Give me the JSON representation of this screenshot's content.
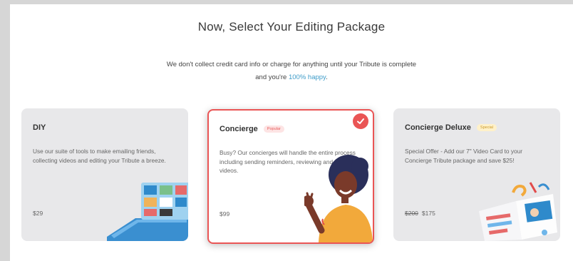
{
  "header": {
    "title": "Now, Select Your Editing Package",
    "subtitle_line1": "We don't collect credit card info or charge for anything until your Tribute is complete",
    "subtitle_line2_prefix": "and you're ",
    "subtitle_line2_accent": "100% happy",
    "subtitle_line2_suffix": "."
  },
  "packages": [
    {
      "name": "DIY",
      "badge": "",
      "description": "Use our suite of tools to make emailing friends, collecting videos and editing your Tribute a breeze.",
      "price_old": "",
      "price": "$29",
      "selected": false,
      "illustration": "laptop-icon"
    },
    {
      "name": "Concierge",
      "badge": "Popular",
      "description": "Busy? Our concierges will handle the entire process including sending reminders, reviewing and editing videos.",
      "price_old": "",
      "price": "$99",
      "selected": true,
      "illustration": "waving-person-icon"
    },
    {
      "name": "Concierge Deluxe",
      "badge": "Special",
      "description": "Special Offer - Add our 7\" Video Card to your Concierge Tribute package and save $25!",
      "price_old": "$200",
      "price": "$175",
      "selected": false,
      "illustration": "video-card-icon"
    }
  ],
  "colors": {
    "accent_red": "#ea5555",
    "accent_blue": "#3e9cc9",
    "card_gray": "#e8e8ea"
  }
}
